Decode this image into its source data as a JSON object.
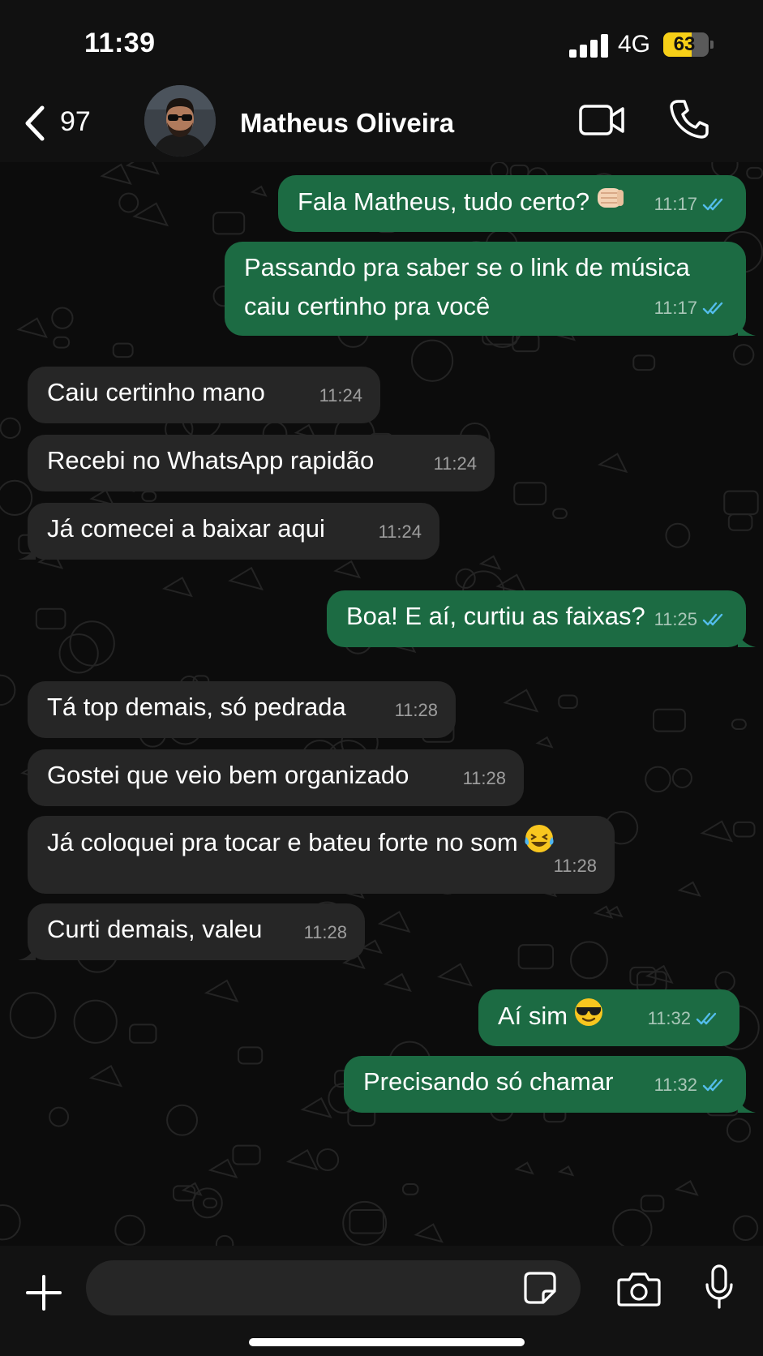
{
  "status_bar": {
    "time": "11:39",
    "network": "4G",
    "battery": "63",
    "battery_level": 0.63
  },
  "header": {
    "back_count": "97",
    "contact_name": "Matheus Oliveira"
  },
  "messages": [
    {
      "dir": "out",
      "text": "Fala Matheus, tudo certo?",
      "emoji": "fist-bump-icon",
      "time": "11:17",
      "read": true
    },
    {
      "dir": "out",
      "text": "Passando pra saber se o link de música\ncaiu certinho pra você",
      "time": "11:17",
      "read": true
    },
    {
      "dir": "in",
      "text": "Caiu certinho mano",
      "time": "11:24"
    },
    {
      "dir": "in",
      "text": "Recebi no WhatsApp rapidão",
      "time": "11:24"
    },
    {
      "dir": "in",
      "text": "Já comecei a baixar aqui",
      "time": "11:24"
    },
    {
      "dir": "out",
      "text": "Boa! E aí, curtiu as faixas?",
      "time": "11:25",
      "read": true
    },
    {
      "dir": "in",
      "text": "Tá top demais, só pedrada",
      "time": "11:28"
    },
    {
      "dir": "in",
      "text": "Gostei que veio bem organizado",
      "time": "11:28"
    },
    {
      "dir": "in",
      "text": "Já coloquei pra tocar e bateu forte no som",
      "emoji": "laughing-tears-icon",
      "time": "11:28"
    },
    {
      "dir": "in",
      "text": "Curti demais, valeu",
      "time": "11:28"
    },
    {
      "dir": "out",
      "text": "Aí sim",
      "emoji": "sunglasses-face-icon",
      "time": "11:32",
      "read": true
    },
    {
      "dir": "out",
      "text": "Precisando só chamar",
      "time": "11:32",
      "read": true
    }
  ],
  "composer": {
    "placeholder": ""
  },
  "colors": {
    "outgoing_bubble": "#1c6b43",
    "incoming_bubble": "#262626",
    "read_ticks": "#53bdeb",
    "battery": "#f6cf17"
  }
}
